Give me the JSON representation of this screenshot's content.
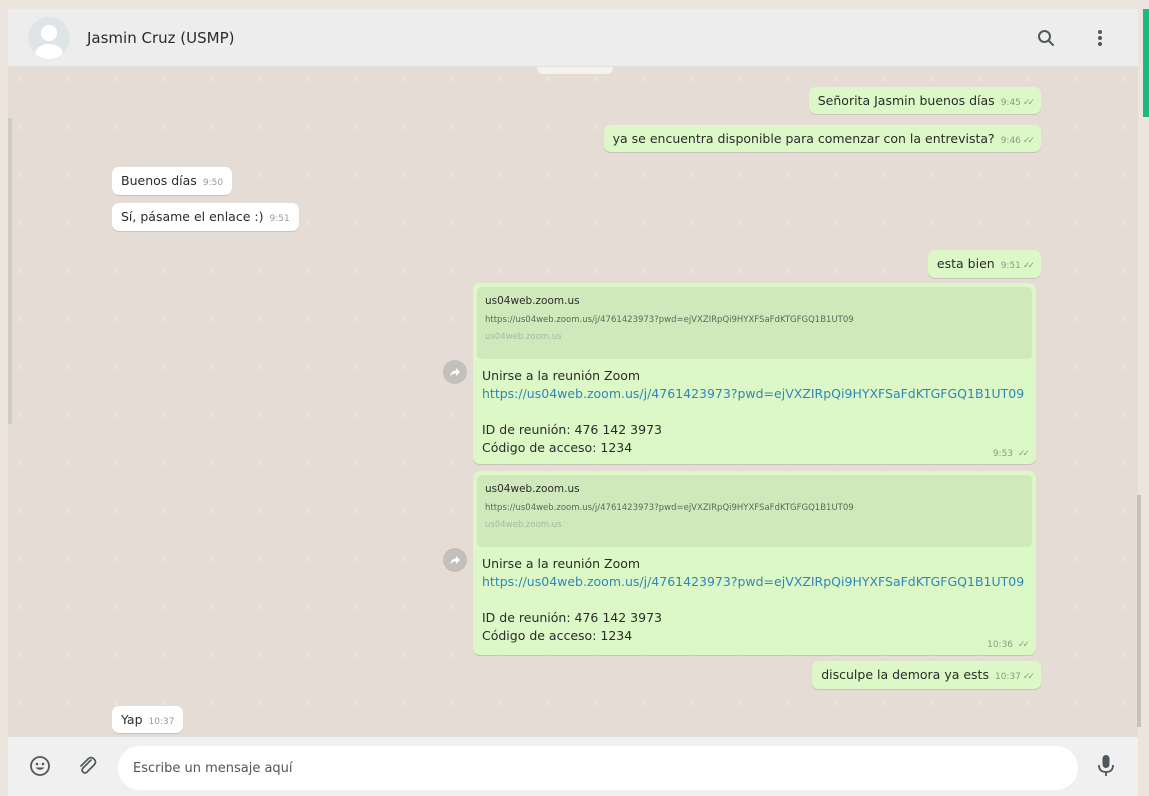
{
  "header": {
    "contact_name": "Jasmin Cruz (USMP)",
    "icons": [
      "avatar",
      "search-icon",
      "menu-icon"
    ]
  },
  "messages": [
    {
      "direction": "out",
      "text": "Señorita Jasmin buenos días",
      "time": "9:45",
      "status": "read"
    },
    {
      "direction": "out",
      "text": "ya se encuentra disponible para comenzar con la entrevista?",
      "time": "9:46",
      "status": "read"
    },
    {
      "direction": "in",
      "text": "Buenos días",
      "time": "9:50"
    },
    {
      "direction": "in",
      "text": "Sí, pásame el enlace :)",
      "time": "9:51"
    },
    {
      "direction": "out",
      "text": "esta bien",
      "time": "9:51",
      "status": "read"
    },
    {
      "direction": "out",
      "forwarded": true,
      "preview": {
        "domain": "us04web.zoom.us",
        "url": "https://us04web.zoom.us/j/4761423973?pwd=ejVXZIRpQi9HYXFSaFdKTGFGQ1B1UT09",
        "site": "us04web.zoom.us"
      },
      "title": "Unirse a la reunión Zoom",
      "link": "https://us04web.zoom.us/j/4761423973?pwd=ejVXZIRpQi9HYXFSaFdKTGFGQ1B1UT09",
      "meeting_id": "ID de reunión: 476 142 3973",
      "access_code": "Código de acceso: 1234",
      "time": "9:53",
      "status": "read"
    },
    {
      "direction": "out",
      "forwarded": true,
      "preview": {
        "domain": "us04web.zoom.us",
        "url": "https://us04web.zoom.us/j/4761423973?pwd=ejVXZIRpQi9HYXFSaFdKTGFGQ1B1UT09",
        "site": "us04web.zoom.us"
      },
      "title": "Unirse a la reunión Zoom",
      "link": "https://us04web.zoom.us/j/4761423973?pwd=ejVXZIRpQi9HYXFSaFdKTGFGQ1B1UT09",
      "meeting_id": "ID de reunión: 476 142 3973",
      "access_code": "Código de acceso: 1234",
      "time": "10:36",
      "status": "read"
    },
    {
      "direction": "out",
      "text": "disculpe la demora ya ests",
      "time": "10:37",
      "status": "read"
    },
    {
      "direction": "in",
      "text": "Yap",
      "time": "10:37"
    }
  ],
  "footer": {
    "placeholder": "Escribe un mensaje aquí",
    "icons": [
      "emoji-icon",
      "attach-icon",
      "microphone-icon"
    ]
  },
  "colors": {
    "outgoing_bubble": "#dcf8c6",
    "incoming_bubble": "#ffffff",
    "chat_background": "#e5ddd5",
    "link": "#2f86b8",
    "accent": "#1eb980"
  }
}
